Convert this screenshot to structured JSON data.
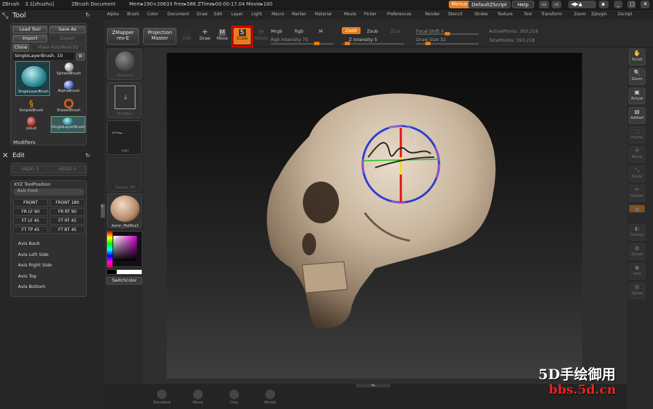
{
  "title_bar": {
    "app": "ZBrush",
    "version": "3.1[zhuzhu]",
    "document": "ZBrush Document",
    "mem": "Mem▸190+20633 Free▸586 ZTime▸00:00:17.04 Movie▸100",
    "menus_label": "Menus",
    "script_label": "DefaultZScript",
    "help_label": "Help"
  },
  "menubar": {
    "items": [
      "Alpha",
      "Brush",
      "Color",
      "Document",
      "Draw",
      "Edit",
      "Layer",
      "Light",
      "Macro",
      "Marker",
      "Material",
      "Movie",
      "Picker",
      "Preferences",
      "Render",
      "Stencil",
      "Stroke",
      "Texture",
      "Tool",
      "Transform",
      "Zoom",
      "Zplugin",
      "Zscript"
    ]
  },
  "shelf": {
    "zmapper": "ZMapper",
    "zmapper_sub": "rev-E",
    "projection": "Projection",
    "projection_sub": "Master",
    "tools": [
      "Edit",
      "Draw",
      "Move",
      "Scale",
      "Rotate"
    ],
    "mrgb": "Mrgb",
    "rgb": "Rgb",
    "m": "M",
    "rgb_intensity": "Rgb Intensity 75",
    "zadd": "Zadd",
    "zsub": "Zsub",
    "zcut": "Zcut",
    "z_intensity": "Z Intensity 5",
    "focal_shift": "Focal Shift 0",
    "draw_size": "Draw Size 32",
    "active_points": "ActivePoints: 393,218",
    "total_points": "TotalPoints: 393,218",
    "rgb_intensity_value": 0.75,
    "z_intensity_value": 0.05,
    "focal_shift_value": 0.5,
    "draw_size_value": 0.16
  },
  "tool_panel": {
    "title": "Tool",
    "load": "Load Tool",
    "save": "Save As",
    "import": "Import",
    "export": "Export",
    "clone": "Clone",
    "make_polymesh": "Make PolyMesh3D",
    "current_brush": "SingleLayerBrush. 10",
    "r": "R",
    "big_brush_label": "SingleLayerBrush",
    "brushes": [
      "SphereBrush",
      "AlphaBrush",
      "SimpleBrush",
      "EraserBrush",
      "zskull",
      "SingleLayerBrush"
    ],
    "modifiers": "Modifiers"
  },
  "edit_panel": {
    "title": "Edit",
    "undo": "UNDO 5",
    "redo": "REDO 0"
  },
  "xyz_panel": {
    "title": "XYZ ToolPosition",
    "axis_front": "Axis Front",
    "buttons": [
      "FRONT",
      "FRONT 180",
      "FR LF 90",
      "FR RT 90",
      "FT LF 45",
      "FT RT 45",
      "FT TP 45",
      "FT BT 45"
    ],
    "axis_items": [
      "Axis Back",
      "Axis Left Side",
      "Axis Right Side",
      "Axis Top",
      "Axis Bottom"
    ]
  },
  "tray": {
    "sphere_label": "Chester3",
    "dragrect": "DragRect",
    "stroke_label": "sign",
    "texture_label": "Texture: Off",
    "material_label": "Aaron_MatBox3",
    "switch_color": "SwitchColor"
  },
  "right_shelf": [
    "Scroll",
    "Zoom",
    "Actual",
    "AAHalf",
    "Frame",
    "Move",
    "Scale",
    "Rotate",
    "PolyF",
    "Transp",
    "Ghost",
    "Solo",
    "Xpose"
  ],
  "bottom": [
    "Standard",
    "Move",
    "Clay",
    "Morph"
  ],
  "watermark": {
    "line1": "5D手绘御用",
    "line2": "bbs.5d.cn"
  },
  "colors": {
    "accent": "#e87b1b",
    "highlight_frame": "#e60000",
    "skull": "#c7b39a"
  }
}
